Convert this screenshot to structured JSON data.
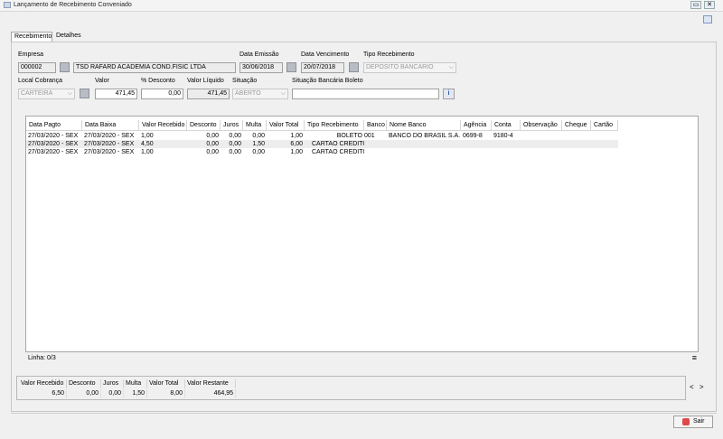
{
  "window": {
    "title": "Lançamento de Recebimento Conveniado"
  },
  "tabs": [
    {
      "label": "Recebimento"
    },
    {
      "label": "Detalhes"
    }
  ],
  "form": {
    "empresa_label": "Empresa",
    "empresa_code": "000002",
    "empresa_name": "TSD RAFARD ACADEMIA COND.FISIC LTDA",
    "data_emissao_label": "Data Emissão",
    "data_emissao": "30/06/2018",
    "data_vencimento_label": "Data Vencimento",
    "data_vencimento": "20/07/2018",
    "tipo_recebimento_label": "Tipo Recebimento",
    "tipo_recebimento": "DEPOSITO BANCARIO",
    "local_cobranca_label": "Local Cobrança",
    "local_cobranca": "CARTEIRA",
    "valor_label": "Valor",
    "valor": "471,45",
    "pct_desconto_label": "% Desconto",
    "pct_desconto": "0,00",
    "valor_liquido_label": "Valor Líquido",
    "valor_liquido": "471,45",
    "situacao_label": "Situação",
    "situacao": "ABERTO",
    "situacao_boleto_label": "Situação Bancária Boleto",
    "situacao_boleto": ""
  },
  "grid": {
    "columns": [
      "Data Pagto",
      "Data Baixa",
      "Valor Recebido",
      "Desconto",
      "Juros",
      "Multa",
      "Valor Total",
      "Tipo Recebimento",
      "Banco",
      "Nome Banco",
      "Agência",
      "Conta",
      "Observação",
      "Cheque",
      "Cartão"
    ],
    "rows": [
      [
        "27/03/2020 - SEX",
        "27/03/2020 - SEX",
        "1,00",
        "0,00",
        "0,00",
        "0,00",
        "1,00",
        "BOLETO",
        "001",
        "BANCO DO BRASIL S.A.",
        "0699-8",
        "9180-4",
        "",
        "",
        ""
      ],
      [
        "27/03/2020 - SEX",
        "27/03/2020 - SEX",
        "4,50",
        "0,00",
        "0,00",
        "1,50",
        "6,00",
        "CARTAO CREDITO",
        "",
        "",
        "",
        "",
        "",
        "",
        ""
      ],
      [
        "27/03/2020 - SEX",
        "27/03/2020 - SEX",
        "1,00",
        "0,00",
        "0,00",
        "0,00",
        "1,00",
        "CARTAO CREDITO",
        "",
        "",
        "",
        "",
        "",
        "",
        ""
      ]
    ],
    "status": "Linha: 0/3"
  },
  "totals": {
    "headers": [
      "Valor Recebido",
      "Desconto",
      "Juros",
      "Multa",
      "Valor Total",
      "Valor Restante"
    ],
    "values": [
      "6,50",
      "0,00",
      "0,00",
      "1,50",
      "8,00",
      "464,95"
    ]
  },
  "nav": {
    "prev": "<",
    "next": ">"
  },
  "buttons": {
    "sair": "Sair"
  }
}
